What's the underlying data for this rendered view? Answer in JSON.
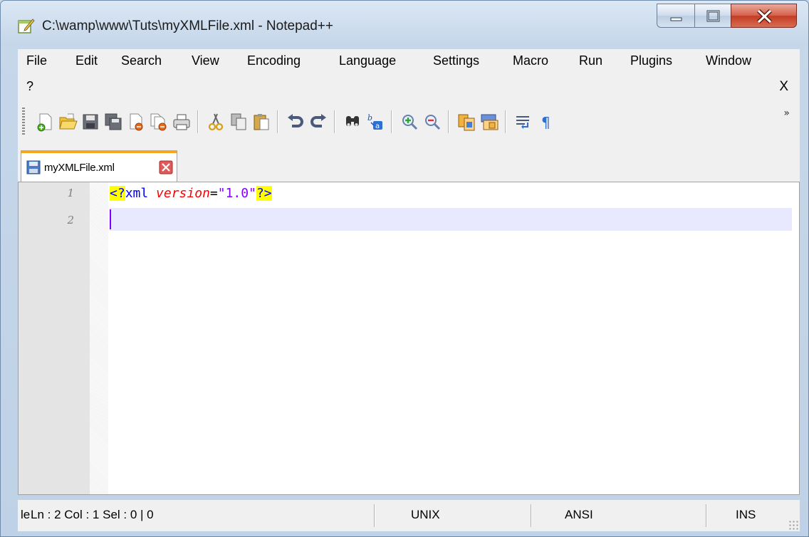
{
  "window": {
    "title": "C:\\wamp\\www\\Tuts\\myXMLFile.xml - Notepad++"
  },
  "icons": {
    "app": "notepad-plus-plus-icon",
    "minimize": "minimize-icon",
    "maximize": "maximize-icon",
    "close": "close-icon"
  },
  "menu": {
    "items": [
      "File",
      "Edit",
      "Search",
      "View",
      "Encoding",
      "Language",
      "Settings",
      "Macro",
      "Run",
      "Plugins",
      "Window"
    ],
    "help": "?",
    "close_doc": "X"
  },
  "toolbar": {
    "buttons": [
      "new-file-icon",
      "open-file-icon",
      "save-icon",
      "save-all-icon",
      "close-icon",
      "close-all-icon",
      "print-icon",
      "cut-icon",
      "copy-icon",
      "paste-icon",
      "undo-icon",
      "redo-icon",
      "find-icon",
      "replace-icon",
      "zoom-in-icon",
      "zoom-out-icon",
      "sync-vertical-icon",
      "sync-horizontal-icon",
      "word-wrap-icon",
      "show-all-chars-icon"
    ],
    "overflow": "»"
  },
  "tabs": [
    {
      "label": "myXMLFile.xml",
      "icon": "saved-file-icon",
      "close_icon": "tab-close-icon"
    }
  ],
  "editor": {
    "line_numbers": [
      "1",
      "2"
    ],
    "line1": {
      "open_bracket": "<?",
      "tag": "xml",
      "attr": "version",
      "eq": "=",
      "value": "\"1.0\"",
      "close_bracket": "?>"
    },
    "current_line": 2
  },
  "statusbar": {
    "truncated": "le",
    "position": "Ln : 2    Col : 1    Sel : 0 | 0",
    "eol": "UNIX",
    "encoding": "ANSI",
    "mode": "INS"
  },
  "colors": {
    "tab_accent": "#f5a623",
    "current_line": "#e8e8ff",
    "xml_bracket_bg": "#ffff00",
    "xml_tag": "#0000ff",
    "xml_attr": "#ff0000",
    "xml_value": "#8000ff"
  }
}
